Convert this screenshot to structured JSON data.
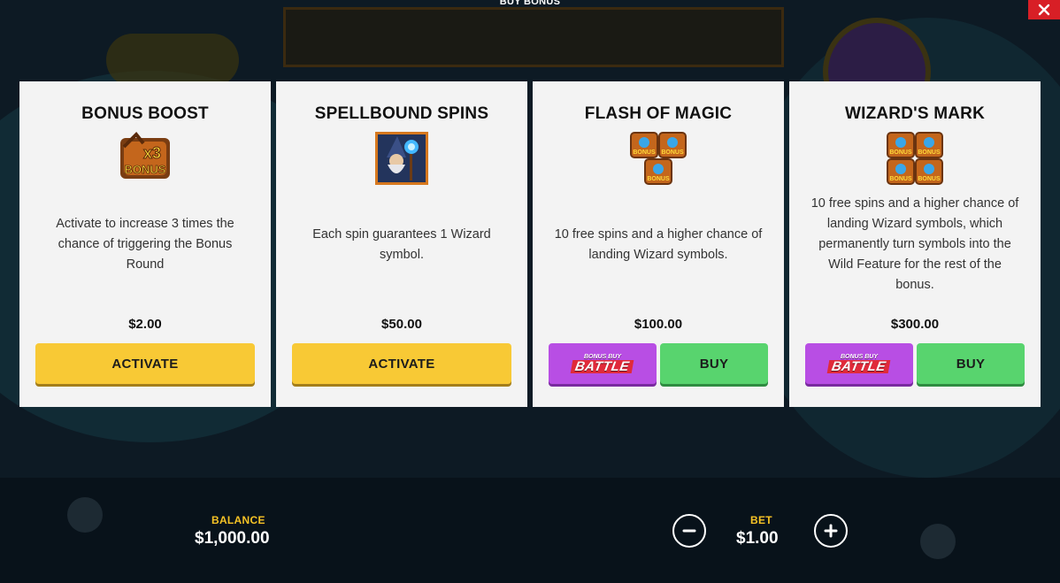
{
  "header": {
    "title": "BUY BONUS"
  },
  "icons": {
    "close": "close-icon",
    "minus": "minus-icon",
    "plus": "plus-icon"
  },
  "colors": {
    "activate": "#f8c935",
    "buy": "#58d46e",
    "battle": "#b84ee4",
    "label": "#f6c325",
    "close": "#d81f26"
  },
  "cards": [
    {
      "title": "BONUS BOOST",
      "icon": "x3-bonus-icon",
      "icon_text_top": "x3",
      "icon_text_bottom": "BONUS",
      "description": "Activate to increase 3 times the chance of triggering the Bonus Round",
      "price": "$2.00",
      "button_label": "ACTIVATE"
    },
    {
      "title": "SPELLBOUND SPINS",
      "icon": "wizard-icon",
      "description": "Each spin guarantees 1 Wizard symbol.",
      "price": "$50.00",
      "button_label": "ACTIVATE"
    },
    {
      "title": "FLASH OF MAGIC",
      "icon": "three-bonus-symbols-icon",
      "description": "10 free spins and a higher chance of landing Wizard symbols.",
      "price": "$100.00",
      "battle_small": "BONUS BUY",
      "battle_big": "BATTLE",
      "button_label": "BUY"
    },
    {
      "title": "WIZARD'S MARK",
      "icon": "four-bonus-symbols-icon",
      "description": "10 free spins and a higher chance of landing Wizard symbols, which permanently turn symbols into the Wild Feature for the rest of the bonus.",
      "price": "$300.00",
      "battle_small": "BONUS BUY",
      "battle_big": "BATTLE",
      "button_label": "BUY"
    }
  ],
  "bonus_symbol_text": "BONUS",
  "footer": {
    "balance_label": "BALANCE",
    "balance_value": "$1,000.00",
    "bet_label": "BET",
    "bet_value": "$1.00"
  }
}
